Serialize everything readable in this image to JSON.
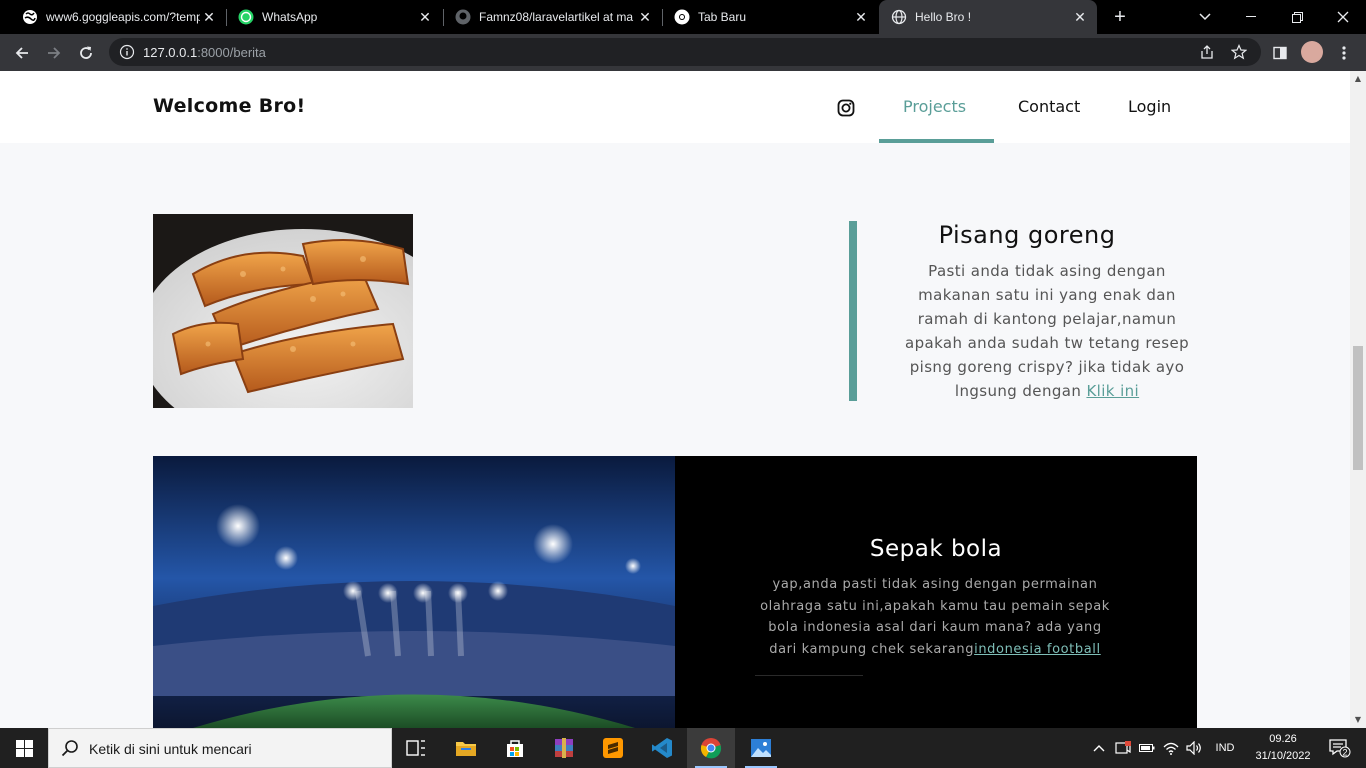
{
  "browser": {
    "tabs": [
      {
        "title": "www6.goggleapis.com/?temp",
        "icon": "globe-icon",
        "active": false
      },
      {
        "title": "WhatsApp",
        "icon": "whatsapp-icon",
        "active": false
      },
      {
        "title": "Famnz08/laravelartikel at ma",
        "icon": "github-icon",
        "active": false
      },
      {
        "title": "Tab Baru",
        "icon": "chrome-icon",
        "active": false
      },
      {
        "title": "Hello Bro !",
        "icon": "globe-icon",
        "active": true
      }
    ],
    "url_host": "127.0.0.1",
    "url_path": ":8000/berita"
  },
  "site": {
    "brand": "Welcome Bro!",
    "nav": [
      {
        "label": "Projects",
        "active": true
      },
      {
        "label": "Contact",
        "active": false
      },
      {
        "label": "Login",
        "active": false
      }
    ],
    "accent_color": "#5a9e98"
  },
  "articles": [
    {
      "title": "Pisang goreng",
      "body": "Pasti anda tidak asing dengan makanan satu ini yang enak dan ramah di kantong pelajar,namun apakah anda sudah tw tetang resep pisng goreng crispy? jika tidak ayo lngsung dengan ",
      "link": "Klik ini"
    },
    {
      "title": "Sepak bola",
      "body": "yap,anda pasti tidak asing dengan permainan olahraga satu ini,apakah kamu tau pemain sepak bola indonesia asal dari kaum mana? ada yang dari kampung chek sekarang",
      "link": "indonesia football"
    }
  ],
  "taskbar": {
    "search_placeholder": "Ketik di sini untuk mencari",
    "language": "IND",
    "time": "09.26",
    "date": "31/10/2022",
    "notifications": "2"
  }
}
